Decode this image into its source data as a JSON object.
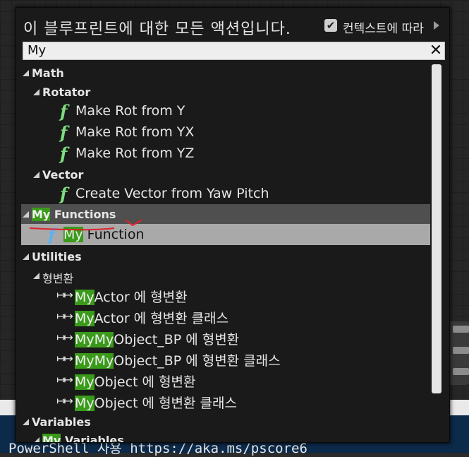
{
  "header": {
    "title": "이 블루프린트에 대한 모든 액션입니다.",
    "context_checked": true,
    "context_label": "컨텍스트에 따라"
  },
  "search": {
    "value": "My"
  },
  "tree": {
    "math": "Math",
    "rotator": "Rotator",
    "make_rot_y": "Make Rot from Y",
    "make_rot_yx": "Make Rot from YX",
    "make_rot_yz": "Make Rot from YZ",
    "vector": "Vector",
    "create_vector": "Create Vector from Yaw Pitch",
    "my_functions_hl": "My",
    "my_functions_rest": " Functions",
    "my_function_hl": "My",
    "my_function_rest": " Function",
    "utilities": "Utilities",
    "cast_category": "형변환",
    "casts": [
      {
        "hl": "My",
        "rest": "Actor 에 형변환"
      },
      {
        "hl": "My",
        "rest": "Actor 에 형변환 클래스"
      },
      {
        "hl": "MyMy",
        "rest": "Object_BP 에 형변환"
      },
      {
        "hl": "MyMy",
        "rest": "Object_BP 에 형변환 클래스"
      },
      {
        "hl": "My",
        "rest": "Object 에 형변환"
      },
      {
        "hl": "My",
        "rest": "Object 에 형변환 클래스"
      }
    ],
    "variables": "Variables",
    "my_variables_hl": "My",
    "my_variables_rest": " Variables"
  },
  "background": {
    "powershell_text": "PowerShell 사용 https://aka.ms/pscore6"
  },
  "colors": {
    "highlight": "#3a9a1a",
    "function_icon": "#7fdc7f",
    "function_icon_selected": "#5eb1f2",
    "selection": "#a9a9a9",
    "annotation": "#e0202a"
  },
  "icons": {
    "function": "function-f-icon",
    "cast": "cast-arrow-icon",
    "expand": "expand-triangle-icon",
    "clear": "close-icon",
    "check": "checkmark-icon"
  }
}
